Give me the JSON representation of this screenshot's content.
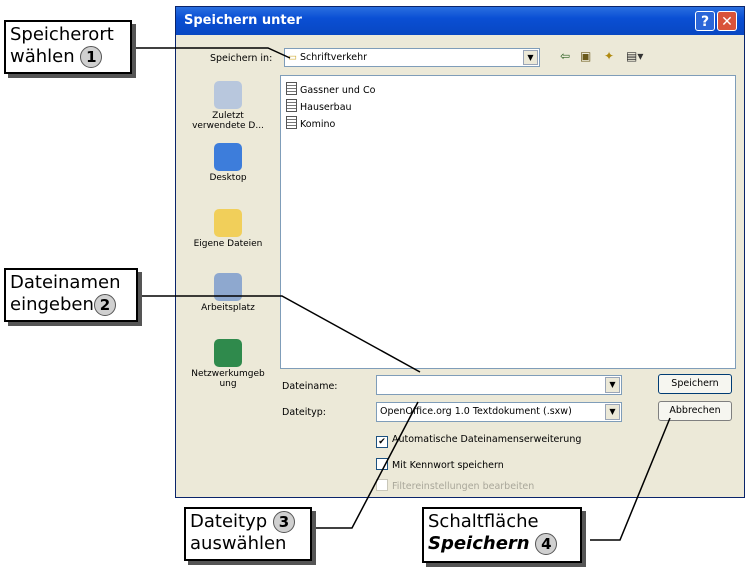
{
  "dialog": {
    "title": "Speichern unter",
    "save_in_label": "Speichern in:",
    "save_in_value": "Schriftverkehr",
    "places": [
      "Zuletzt verwendete D...",
      "Desktop",
      "Eigene Dateien",
      "Arbeitsplatz",
      "Netzwerkumgeb ung"
    ],
    "files": [
      "Gassner und Co",
      "Hauserbau",
      "Komino"
    ],
    "filename_label": "Dateiname:",
    "filename_value": "",
    "filetype_label": "Dateityp:",
    "filetype_value": "OpenOffice.org 1.0 Textdokument (.sxw)",
    "save_button": "Speichern",
    "cancel_button": "Abbrechen",
    "check_auto_ext": "Automatische Dateinamenserweiterung",
    "check_password": "Mit Kennwort speichern",
    "check_filter": "Filtereinstellungen bearbeiten",
    "help_glyph": "?",
    "close_glyph": "✕"
  },
  "callouts": {
    "c1_line1": "Speicherort",
    "c1_line2": "wählen",
    "c1_num": "1",
    "c2_line1": "Dateinamen",
    "c2_line2": "eingeben",
    "c2_num": "2",
    "c3_line1": "Dateityp",
    "c3_line2": "auswählen",
    "c3_num": "3",
    "c4_line1": "Schaltfläche",
    "c4_line2": "Speichern",
    "c4_num": "4"
  }
}
